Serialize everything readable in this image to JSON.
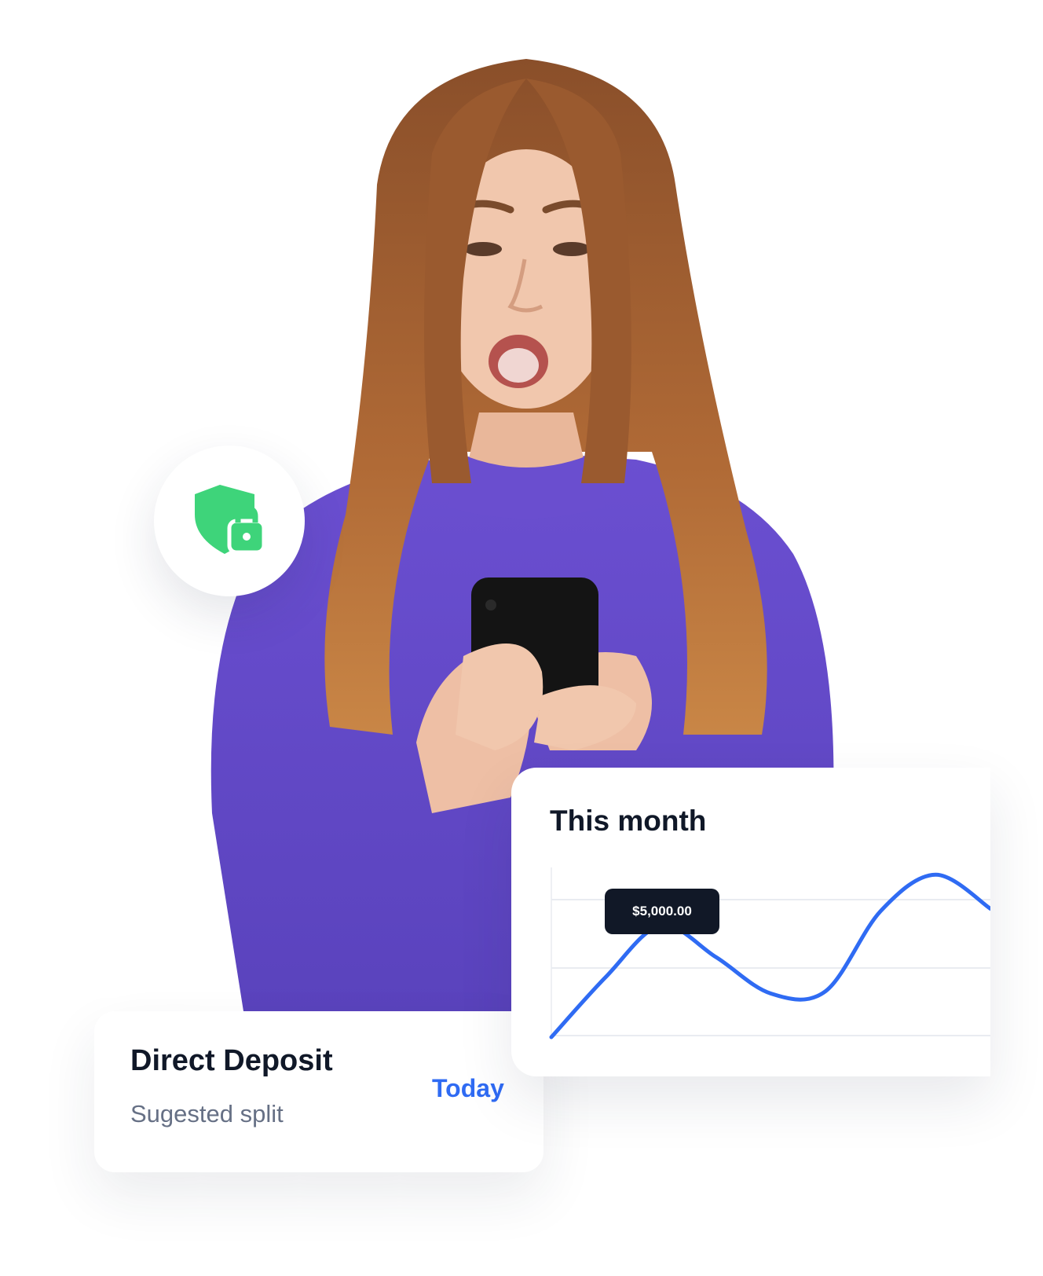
{
  "deposit_card": {
    "title": "Direct Deposit",
    "subtitle": "Sugested split",
    "when": "Today"
  },
  "month_card": {
    "title": "This month",
    "tooltip": "$5,000.00"
  },
  "colors": {
    "accent_blue": "#2f6bf3",
    "shield_green": "#3ed47a",
    "text_dark": "#101828",
    "text_muted": "#667085",
    "tooltip_bg": "#111827"
  },
  "icons": {
    "security": "shield-lock-icon"
  },
  "chart_data": {
    "type": "line",
    "x": [
      0,
      1,
      2,
      3,
      4,
      5,
      6,
      7,
      8
    ],
    "series": [
      {
        "values": [
          0.0,
          2.5,
          4.6,
          3.3,
          1.8,
          1.9,
          5.2,
          6.7,
          5.3
        ]
      }
    ],
    "ylim": [
      0,
      7
    ],
    "grid": true,
    "highlight_index": 2,
    "highlight_label": "$5,000.00"
  }
}
